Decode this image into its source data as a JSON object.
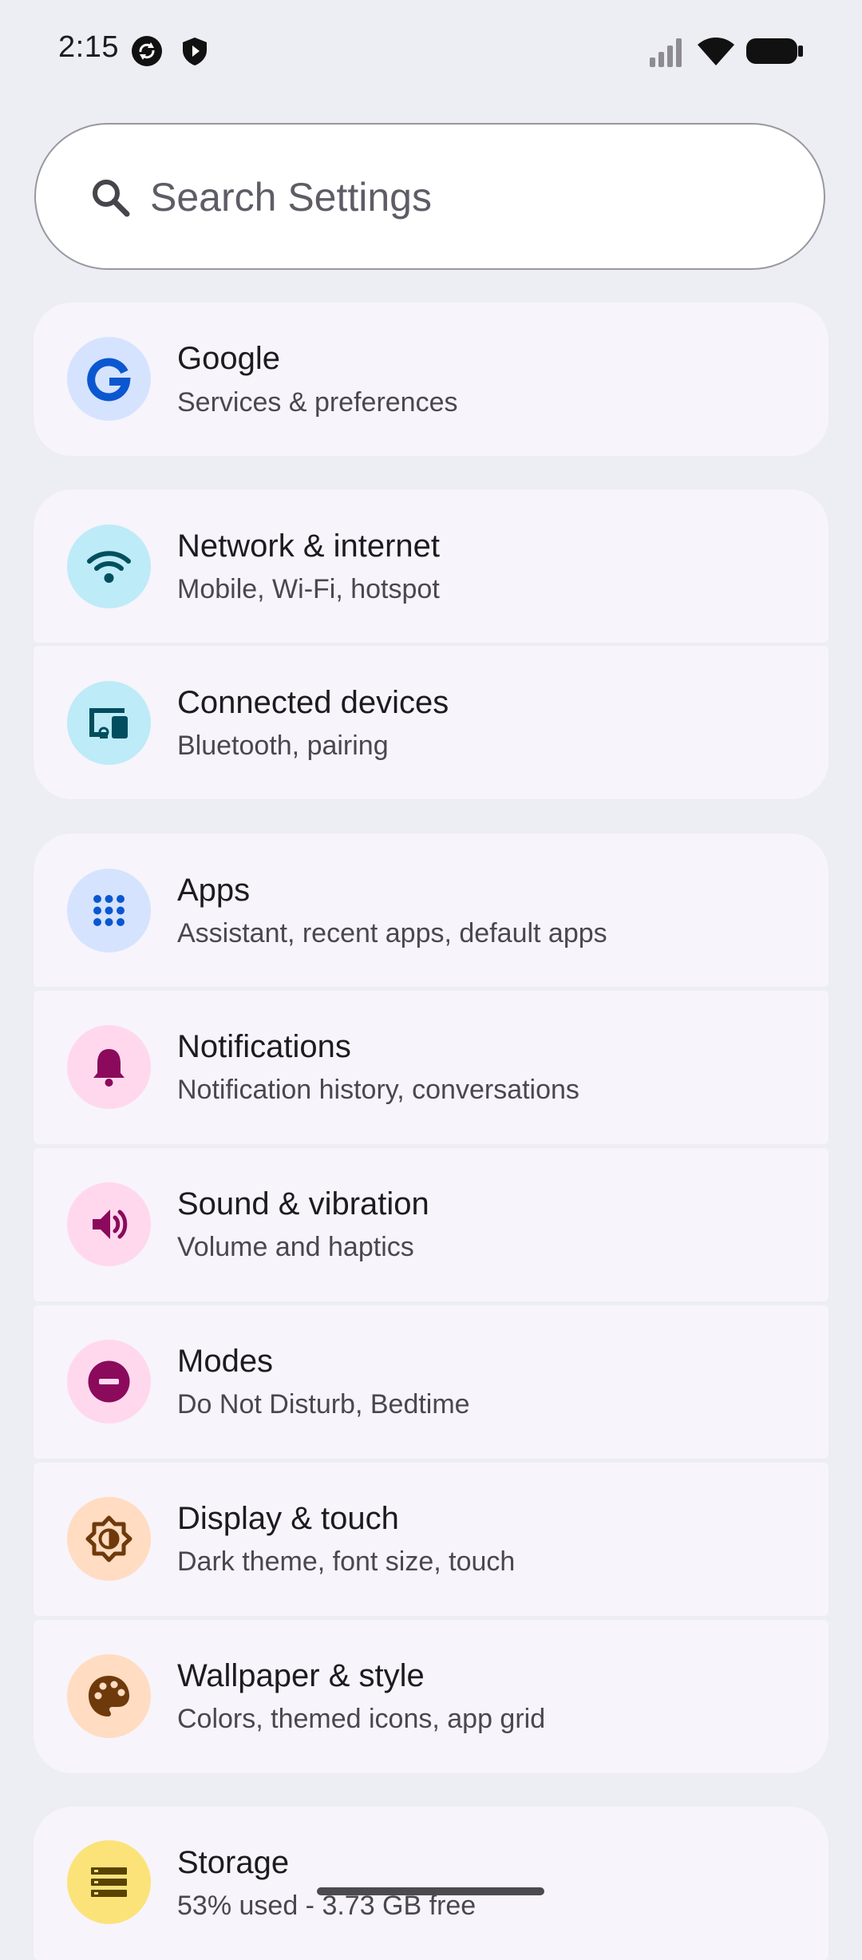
{
  "status_bar": {
    "time": "2:15",
    "left_icons": [
      "sync-icon",
      "shield-icon"
    ],
    "right_icons": [
      "signal-icon",
      "wifi-icon",
      "battery-icon"
    ]
  },
  "search": {
    "placeholder": "Search Settings",
    "icon": "search-icon"
  },
  "items": [
    {
      "id": "google",
      "title": "Google",
      "subtitle": "Services & preferences",
      "icon": "google-g-icon",
      "icon_bg": "#D6E3FF",
      "icon_color": "#0B57D0"
    },
    {
      "id": "network",
      "title": "Network & internet",
      "subtitle": "Mobile, Wi-Fi, hotspot",
      "icon": "wifi-icon",
      "icon_bg": "#BDEBF7",
      "icon_color": "#004E5E"
    },
    {
      "id": "connected",
      "title": "Connected devices",
      "subtitle": "Bluetooth, pairing",
      "icon": "devices-icon",
      "icon_bg": "#BDEBF7",
      "icon_color": "#004E5E"
    },
    {
      "id": "apps",
      "title": "Apps",
      "subtitle": "Assistant, recent apps, default apps",
      "icon": "apps-grid-icon",
      "icon_bg": "#D6E3FF",
      "icon_color": "#0B57D0"
    },
    {
      "id": "notifications",
      "title": "Notifications",
      "subtitle": "Notification history, conversations",
      "icon": "bell-icon",
      "icon_bg": "#FFD8EE",
      "icon_color": "#8B0A5C"
    },
    {
      "id": "sound",
      "title": "Sound & vibration",
      "subtitle": "Volume and haptics",
      "icon": "speaker-icon",
      "icon_bg": "#FFD8EE",
      "icon_color": "#8B0A5C"
    },
    {
      "id": "modes",
      "title": "Modes",
      "subtitle": "Do Not Disturb, Bedtime",
      "icon": "do-not-disturb-icon",
      "icon_bg": "#FFD8EE",
      "icon_color": "#8B0A5C"
    },
    {
      "id": "display",
      "title": "Display & touch",
      "subtitle": "Dark theme, font size, touch",
      "icon": "brightness-icon",
      "icon_bg": "#FFDCC2",
      "icon_color": "#6E3A0B"
    },
    {
      "id": "wallpaper",
      "title": "Wallpaper & style",
      "subtitle": "Colors, themed icons, app grid",
      "icon": "palette-icon",
      "icon_bg": "#FFDCC2",
      "icon_color": "#6E3A0B"
    },
    {
      "id": "storage",
      "title": "Storage",
      "subtitle": "53% used - 3.73 GB free",
      "icon": "storage-icon",
      "icon_bg": "#FBE37A",
      "icon_color": "#5A4300"
    }
  ]
}
